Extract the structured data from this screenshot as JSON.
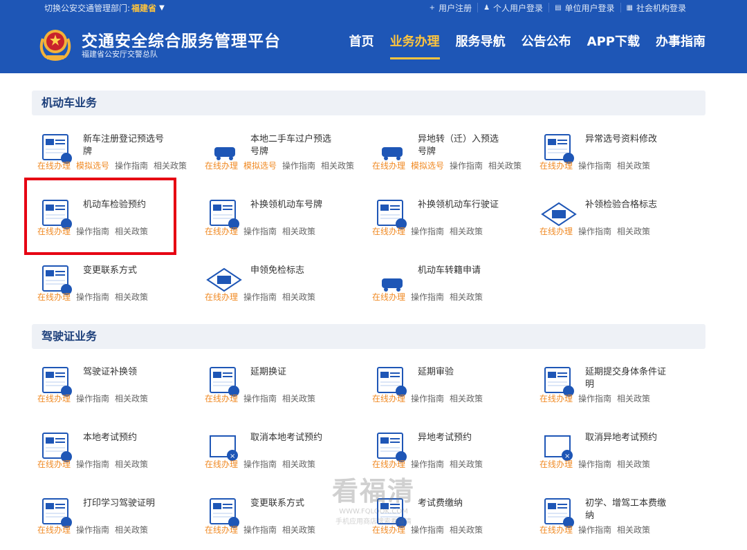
{
  "topbar": {
    "dept_label": "切换公安交通管理部门:",
    "dept_value": "福建省",
    "links": [
      {
        "icon": "plus-icon",
        "glyph": "+",
        "label": "用户注册"
      },
      {
        "icon": "person-icon",
        "glyph": "♟",
        "label": "个人用户登录"
      },
      {
        "icon": "building-icon",
        "glyph": "▤",
        "label": "单位用户登录"
      },
      {
        "icon": "org-icon",
        "glyph": "▦",
        "label": "社会机构登录"
      }
    ]
  },
  "header": {
    "title": "交通安全综合服务管理平台",
    "subtitle": "福建省公安厅交警总队",
    "nav": [
      {
        "label": "首页",
        "active": false
      },
      {
        "label": "业务办理",
        "active": true
      },
      {
        "label": "服务导航",
        "active": false
      },
      {
        "label": "公告公布",
        "active": false
      },
      {
        "label": "APP下载",
        "active": false
      },
      {
        "label": "办事指南",
        "active": false
      }
    ]
  },
  "links_text": {
    "online": "在线办理",
    "sim": "模拟选号",
    "guide": "操作指南",
    "policy": "相关政策"
  },
  "sections": [
    {
      "title": "机动车业务",
      "items": [
        {
          "title": "新车注册登记预选号牌",
          "icon": "plate-preselect-icon",
          "sim": true
        },
        {
          "title": "本地二手车过户预选号牌",
          "icon": "car-transfer-icon",
          "sim": true
        },
        {
          "title": "异地转（迁）入预选号牌",
          "icon": "car-relocate-icon",
          "sim": true
        },
        {
          "title": "异常选号资料修改",
          "icon": "number-edit-icon",
          "sim": false
        },
        {
          "title": "机动车检验预约",
          "icon": "inspection-appointment-icon",
          "sim": false
        },
        {
          "title": "补换领机动车号牌",
          "icon": "plate-replace-icon",
          "sim": false
        },
        {
          "title": "补换领机动车行驶证",
          "icon": "license-replace-icon",
          "sim": false
        },
        {
          "title": "补领检验合格标志",
          "icon": "inspection-mark-icon",
          "sim": false
        },
        {
          "title": "变更联系方式",
          "icon": "contact-change-icon",
          "sim": false
        },
        {
          "title": "申领免检标志",
          "icon": "exempt-mark-icon",
          "sim": false
        },
        {
          "title": "机动车转籍申请",
          "icon": "vehicle-transfer-icon",
          "sim": false
        }
      ]
    },
    {
      "title": "驾驶证业务",
      "items": [
        {
          "title": "驾驶证补换领",
          "icon": "driver-license-icon",
          "sim": false
        },
        {
          "title": "延期换证",
          "icon": "extend-license-icon",
          "sim": false
        },
        {
          "title": "延期审验",
          "icon": "extend-review-icon",
          "sim": false
        },
        {
          "title": "延期提交身体条件证明",
          "icon": "health-proof-icon",
          "sim": false
        },
        {
          "title": "本地考试预约",
          "icon": "local-exam-icon",
          "sim": false
        },
        {
          "title": "取消本地考试预约",
          "icon": "cancel-local-exam-icon",
          "sim": false
        },
        {
          "title": "异地考试预约",
          "icon": "remote-exam-icon",
          "sim": false
        },
        {
          "title": "取消异地考试预约",
          "icon": "cancel-remote-exam-icon",
          "sim": false
        },
        {
          "title": "打印学习驾驶证明",
          "icon": "print-learner-icon",
          "sim": false
        },
        {
          "title": "变更联系方式",
          "icon": "contact-change-icon",
          "sim": false
        },
        {
          "title": "考试费缴纳",
          "icon": "exam-fee-icon",
          "sim": false
        },
        {
          "title": "初学、增驾工本费缴纳",
          "icon": "fee-pay-icon",
          "sim": false
        }
      ]
    }
  ],
  "watermark": {
    "line1": "看福清",
    "line2": "WWW.FQLOOK.COM",
    "line3": "手机应用商店搜索看福清"
  },
  "colors": {
    "primary": "#1e56b6",
    "accent": "#ffc53d",
    "link_orange": "#f08a24",
    "highlight": "#e60012"
  }
}
